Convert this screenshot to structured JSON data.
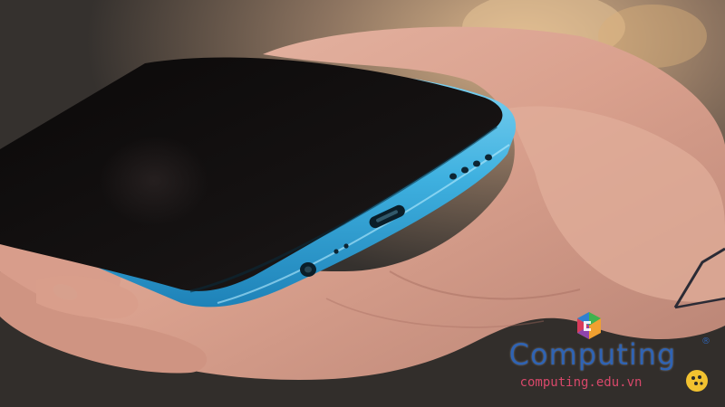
{
  "photo": {
    "subject": "blue smartphone held in hand, bottom edge with ports",
    "colors": {
      "phone_frame": "#47b6e3",
      "phone_screen": "#0f0d0d",
      "skin": "#d9a796",
      "background": "#3a3633"
    }
  },
  "watermark": {
    "brand": "Computing",
    "registered": "®",
    "url": "computing.edu.vn",
    "logo_icon": "computing-logo-icon",
    "badge_icon": "yellow-circle-badge-icon",
    "colors": {
      "brand": "#2f63b3",
      "url": "#d8486a"
    }
  }
}
